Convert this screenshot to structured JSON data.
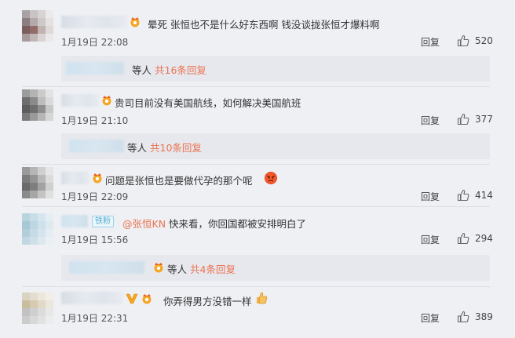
{
  "comments": [
    {
      "text": "晕死 张恒也不是什么好东西啊 钱没谈拢张恒才爆料啊",
      "time": "1月19日 22:08",
      "reply_label": "回复",
      "likes": "520",
      "sub": {
        "deng": "等人",
        "more": "共16条回复"
      }
    },
    {
      "text": "贵司目前没有美国航线，如何解决美国航班",
      "time": "1月19日 21:10",
      "reply_label": "回复",
      "likes": "377",
      "sub": {
        "deng": "等人",
        "more": "共10条回复"
      }
    },
    {
      "text": "问题是张恒也是要做代孕的那个呢",
      "time": "1月19日 22:09",
      "reply_label": "回复",
      "likes": "414"
    },
    {
      "badge": "铁粉",
      "mention": "@张恒KN",
      "text": " 快来看，你回国都被安排明白了",
      "time": "1月19日 15:56",
      "reply_label": "回复",
      "likes": "294",
      "sub": {
        "deng": "等人",
        "more": "共4条回复"
      }
    },
    {
      "text": "你弄得男方没错一样",
      "time": "1月19日 22:31",
      "reply_label": "回复",
      "likes": "389"
    }
  ],
  "icons": {
    "vip": "vip-crown-icon",
    "like": "thumbs-up-icon",
    "emoji_angry": "angry-face-emoji",
    "emoji_thumb": "thumbs-up-emoji",
    "verified": "v-verified-icon"
  },
  "colors": {
    "link": "#eb7350",
    "background": "#eef0f4"
  }
}
